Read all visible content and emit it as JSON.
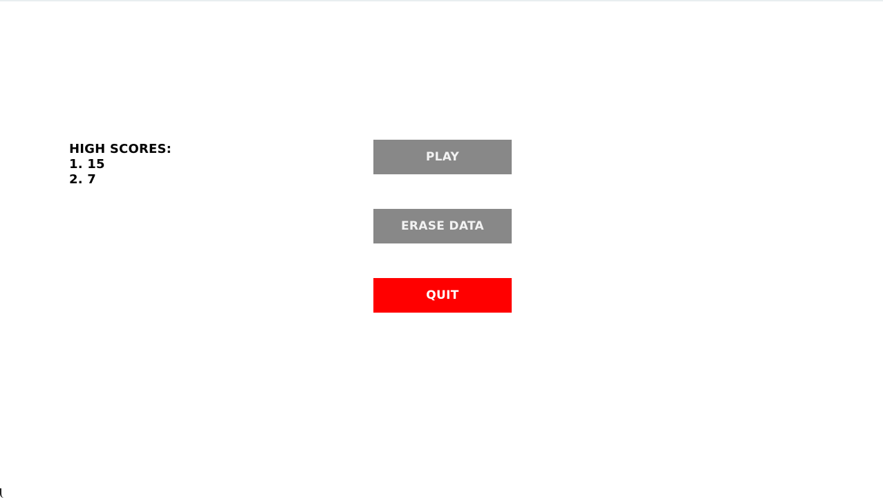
{
  "high_scores": {
    "heading": "HIGH SCORES:",
    "entries": [
      "1. 15",
      "2. 7"
    ]
  },
  "menu": {
    "play_label": "PLAY",
    "erase_label": "ERASE DATA",
    "quit_label": "QUIT"
  },
  "colors": {
    "button_gray": "#888888",
    "button_quit": "#ff0000",
    "text_dark": "#000000",
    "background": "#ffffff"
  }
}
